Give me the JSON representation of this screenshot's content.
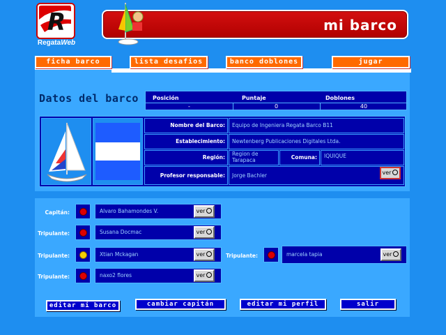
{
  "brand": {
    "logo_letter": "R",
    "name_part1": "Regata",
    "name_part2": "Web"
  },
  "header": {
    "title": "mi barco"
  },
  "nav": {
    "items": [
      {
        "label": "ficha barco"
      },
      {
        "label": "lista desafios"
      },
      {
        "label": "banco doblones"
      },
      {
        "label": "jugar"
      }
    ]
  },
  "boat": {
    "section_title": "Datos del barco",
    "stats": {
      "position_label": "Posición",
      "position_value": "-",
      "score_label": "Puntaje",
      "score_value": "0",
      "doubloons_label": "Doblones",
      "doubloons_value": "40"
    },
    "fields": {
      "name_label": "Nombre del Barco:",
      "name_value": "Equipo de Ingeniera Regata Barco B11",
      "establishment_label": "Establecimiento:",
      "establishment_value": "Newtenberg Publicaciones Digitales Ltda.",
      "region_label": "Región:",
      "region_value": "Region de Tarapaca",
      "commune_label": "Comuna:",
      "commune_value": "IQUIQUE",
      "teacher_label": "Profesor responsable:",
      "teacher_value": "Jorge Bachler"
    },
    "ver_label": "ver"
  },
  "crew": {
    "captain": {
      "role": "Capitán:",
      "name": "Alvaro Bahamondes V."
    },
    "members": [
      {
        "role": "Tripulante:",
        "name": "Susana Docmac"
      },
      {
        "role": "Tripulante:",
        "name": "Xtian Mckagan"
      },
      {
        "role": "Tripulante:",
        "name": "naxo2 flores"
      },
      {
        "role": "Tripulante:",
        "name": "marcela tapia"
      }
    ],
    "ver_label": "ver"
  },
  "actions": {
    "edit_boat": "editar mi barco",
    "change_captain": "cambiar capitán",
    "edit_profile": "editar mi perfil",
    "exit": "salir"
  },
  "colors": {
    "background": "#1e8ef0",
    "panel": "#3aa8ff",
    "box": "#0000aa",
    "accent": "#ff6a00",
    "banner": "#cc0000"
  }
}
